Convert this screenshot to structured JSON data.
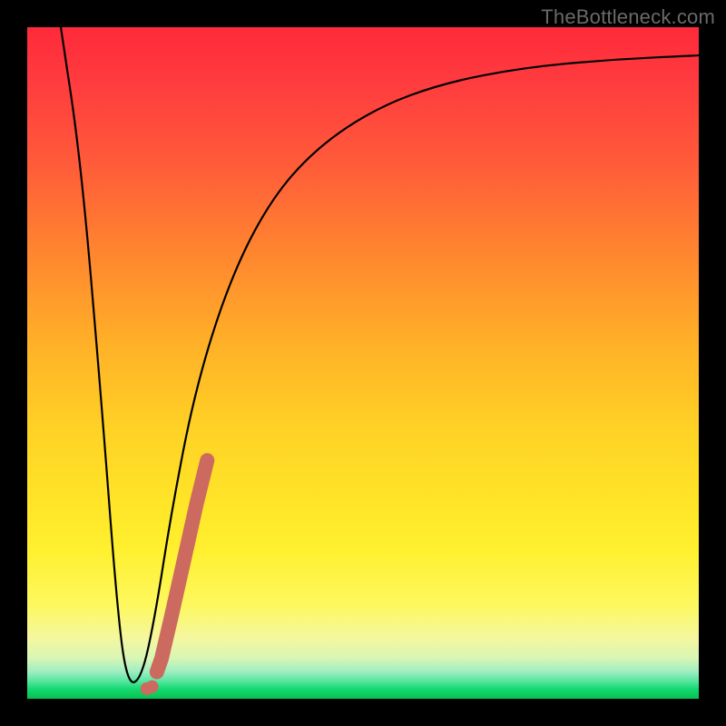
{
  "watermark": "TheBottleneck.com",
  "chart_data": {
    "type": "line",
    "title": "",
    "xlabel": "",
    "ylabel": "",
    "xlim": [
      0,
      1
    ],
    "ylim": [
      0,
      1
    ],
    "series": [
      {
        "name": "bottleneck-curve",
        "x": [
          0.05,
          0.08,
          0.11,
          0.135,
          0.15,
          0.17,
          0.19,
          0.215,
          0.25,
          0.3,
          0.36,
          0.43,
          0.52,
          0.62,
          0.74,
          0.87,
          1.0
        ],
        "y": [
          1.0,
          0.8,
          0.45,
          0.12,
          0.02,
          0.03,
          0.12,
          0.28,
          0.46,
          0.62,
          0.74,
          0.82,
          0.88,
          0.917,
          0.94,
          0.952,
          0.958
        ]
      }
    ],
    "highlight_segment": {
      "name": "highlight-stroke",
      "color": "#cc6a5f",
      "points_xy": [
        [
          0.178,
          0.015
        ],
        [
          0.186,
          0.018
        ],
        [
          0.193,
          0.04
        ],
        [
          0.2,
          0.06
        ],
        [
          0.214,
          0.12
        ],
        [
          0.232,
          0.2
        ],
        [
          0.252,
          0.29
        ],
        [
          0.268,
          0.355
        ]
      ]
    },
    "background_gradient_stops": [
      {
        "pos": 0.0,
        "color": "#ff2a3a"
      },
      {
        "pos": 0.35,
        "color": "#ff8a2e"
      },
      {
        "pos": 0.7,
        "color": "#ffe327"
      },
      {
        "pos": 0.94,
        "color": "#d8f6b4"
      },
      {
        "pos": 1.0,
        "color": "#06c14e"
      }
    ]
  }
}
